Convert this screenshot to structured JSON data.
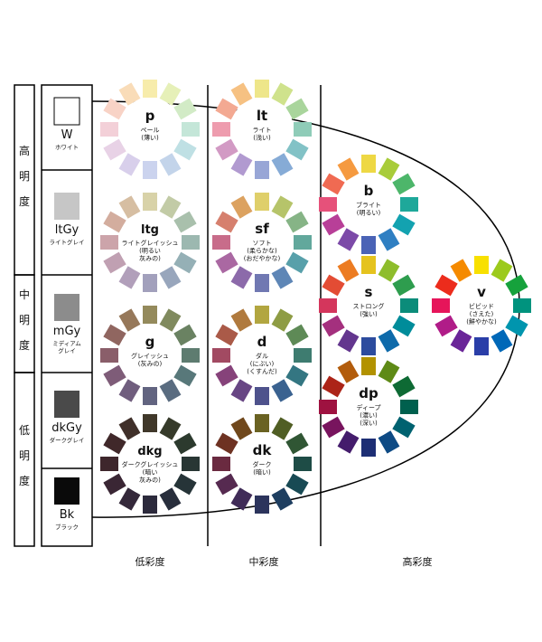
{
  "lightness_groups": [
    {
      "id": "high",
      "label": "高明度"
    },
    {
      "id": "mid",
      "label": "中明度"
    },
    {
      "id": "low",
      "label": "低明度"
    }
  ],
  "achromatic": [
    {
      "code": "W",
      "name": "ホワイト",
      "color": "#ffffff"
    },
    {
      "code": "ltGy",
      "name": "ライトグレイ",
      "color": "#c6c6c6"
    },
    {
      "code": "mGy",
      "name": "ミディアム\nグレイ",
      "color": "#8c8c8c"
    },
    {
      "code": "dkGy",
      "name": "ダークグレイ",
      "color": "#4a4a4a"
    },
    {
      "code": "Bk",
      "name": "ブラック",
      "color": "#0a0a0a"
    }
  ],
  "chroma_groups": [
    {
      "id": "low",
      "label": "低彩度"
    },
    {
      "id": "mid",
      "label": "中彩度"
    },
    {
      "id": "high",
      "label": "高彩度"
    }
  ],
  "tones": [
    {
      "code": "p",
      "name": "ペール\n(薄い)",
      "colors": [
        "#f7ecab",
        "#e6f0b8",
        "#d2ebc6",
        "#c4e6d8",
        "#bfe0e4",
        "#c3d4ea",
        "#cbd3ee",
        "#d8cfeb",
        "#e8d2e6",
        "#f3d0d8",
        "#f8d3c6",
        "#f9dcb8"
      ]
    },
    {
      "code": "lt",
      "name": "ライト\n(浅い)",
      "colors": [
        "#eee68a",
        "#cfe28c",
        "#a9d59c",
        "#8fccb8",
        "#82c2c6",
        "#86abd6",
        "#98a6d6",
        "#b19ad0",
        "#d29ac4",
        "#ee9cae",
        "#f3a992",
        "#f6c182"
      ]
    },
    {
      "code": "b",
      "name": "ブライト\n(明るい)",
      "colors": [
        "#eed844",
        "#a8cc3a",
        "#4db66a",
        "#1ea89a",
        "#13a2b0",
        "#2f7fc2",
        "#4a63b6",
        "#7c4aa8",
        "#b83f98",
        "#e6517a",
        "#f06a52",
        "#f59a40"
      ]
    },
    {
      "code": "ltg",
      "name": "ライトグレイッシュ\n(明るい\n灰みの)",
      "colors": [
        "#d8d2a8",
        "#c2cba6",
        "#a9c0ac",
        "#9cb8b0",
        "#95b0b6",
        "#98a6bc",
        "#a2a0bc",
        "#b19fba",
        "#c0a0b2",
        "#cca4aa",
        "#d3ad9e",
        "#d6bea2"
      ]
    },
    {
      "code": "sf",
      "name": "ソフト\n(柔らかな)\n(おだやかな)",
      "colors": [
        "#dfcf6a",
        "#b6c46a",
        "#86b486",
        "#62a89c",
        "#58a0aa",
        "#5e86b6",
        "#7078b2",
        "#8c6aaa",
        "#aa68a2",
        "#c86c8a",
        "#d6806e",
        "#dca260"
      ]
    },
    {
      "code": "s",
      "name": "ストロング\n(強い)",
      "colors": [
        "#e5c31e",
        "#8ebd2c",
        "#2e9d4e",
        "#0b8c7a",
        "#008c9a",
        "#0e6aaa",
        "#2d4c9e",
        "#63368e",
        "#a4307e",
        "#d4365c",
        "#e34c34",
        "#ec7c22"
      ]
    },
    {
      "code": "v",
      "name": "ビビッド\n(さえた)\n(鮮やかな)",
      "colors": [
        "#f8e000",
        "#9cca1c",
        "#16a23c",
        "#00937e",
        "#0095ae",
        "#0068b8",
        "#2a3ea8",
        "#6a2598",
        "#b01c88",
        "#e6155a",
        "#ec2c1c",
        "#f58a00"
      ]
    },
    {
      "code": "g",
      "name": "グレイッシュ\n(灰みの)",
      "colors": [
        "#948a5c",
        "#808a5e",
        "#6a8262",
        "#5e7c70",
        "#58787a",
        "#5a6c80",
        "#626480",
        "#705e7e",
        "#7e5c78",
        "#8a5e6a",
        "#906660",
        "#96785a"
      ]
    },
    {
      "code": "d",
      "name": "ダル\n(にぶい)\n(くすんだ)",
      "colors": [
        "#b2a640",
        "#8e9c44",
        "#5e8a56",
        "#3e7c70",
        "#347682",
        "#3a6290",
        "#4e528c",
        "#684684",
        "#86427a",
        "#a24a62",
        "#aa5a48",
        "#b07a3e"
      ]
    },
    {
      "code": "dp",
      "name": "ディープ\n(濃い)\n(深い)",
      "colors": [
        "#b29200",
        "#5e8a16",
        "#0e6a34",
        "#00604e",
        "#006270",
        "#0d4a84",
        "#1d2e74",
        "#441c6c",
        "#78145e",
        "#9e1240",
        "#ac2418",
        "#b25c0c"
      ]
    },
    {
      "code": "dkg",
      "name": "ダークグレイッシュ\n(暗い\n灰みの)",
      "colors": [
        "#40382a",
        "#363a2a",
        "#2c3a2e",
        "#283634",
        "#263438",
        "#282e3c",
        "#2c2a3c",
        "#34283a",
        "#3a2634",
        "#3e262c",
        "#40282a",
        "#40302a"
      ]
    },
    {
      "code": "dk",
      "name": "ダーク\n(暗い)",
      "colors": [
        "#6a6222",
        "#505e24",
        "#305634",
        "#1e4c46",
        "#184a54",
        "#1e3e60",
        "#2c345c",
        "#402c58",
        "#562a50",
        "#6a2a40",
        "#6e3222",
        "#70481c"
      ]
    }
  ]
}
